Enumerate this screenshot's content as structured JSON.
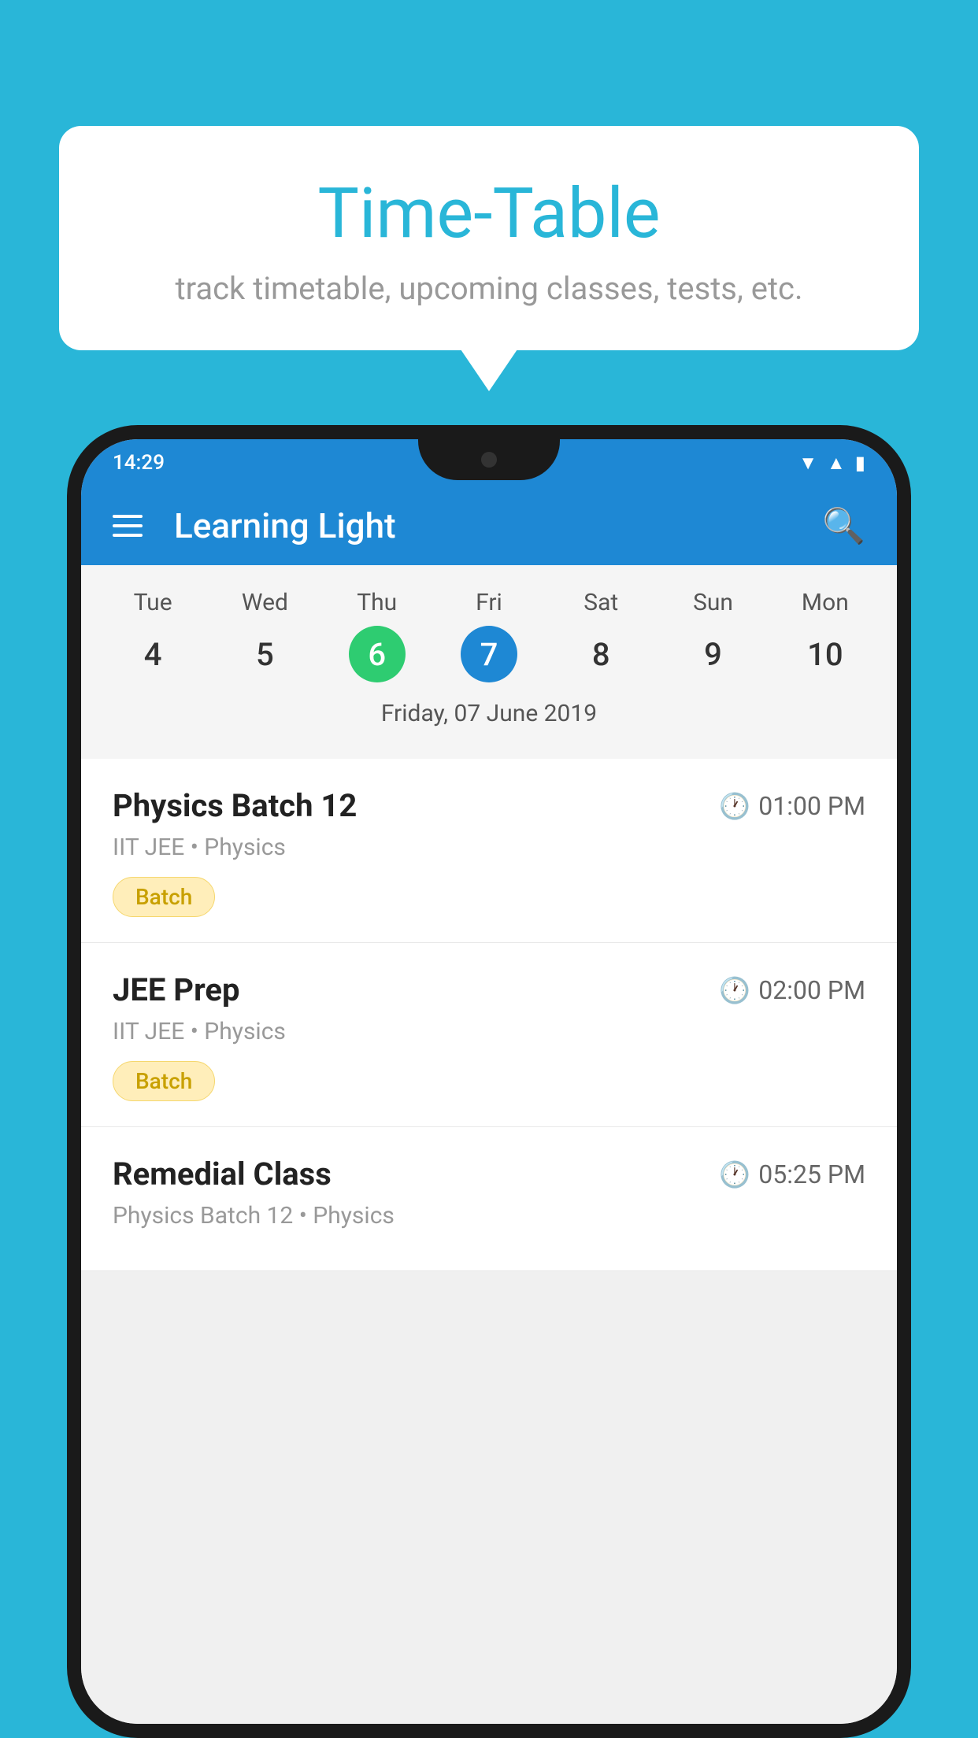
{
  "background_color": "#29b6d8",
  "bubble": {
    "title": "Time-Table",
    "subtitle": "track timetable, upcoming classes, tests, etc."
  },
  "app": {
    "title": "Learning Light",
    "menu_icon": "hamburger-icon",
    "search_icon": "search-icon"
  },
  "status_bar": {
    "time": "14:29",
    "icons": [
      "wifi",
      "signal",
      "battery"
    ]
  },
  "calendar": {
    "days": [
      {
        "name": "Tue",
        "number": "4",
        "state": "normal"
      },
      {
        "name": "Wed",
        "number": "5",
        "state": "normal"
      },
      {
        "name": "Thu",
        "number": "6",
        "state": "today"
      },
      {
        "name": "Fri",
        "number": "7",
        "state": "selected"
      },
      {
        "name": "Sat",
        "number": "8",
        "state": "normal"
      },
      {
        "name": "Sun",
        "number": "9",
        "state": "normal"
      },
      {
        "name": "Mon",
        "number": "10",
        "state": "normal"
      }
    ],
    "selected_date_label": "Friday, 07 June 2019"
  },
  "events": [
    {
      "name": "Physics Batch 12",
      "time": "01:00 PM",
      "meta": "IIT JEE • Physics",
      "tag": "Batch"
    },
    {
      "name": "JEE Prep",
      "time": "02:00 PM",
      "meta": "IIT JEE • Physics",
      "tag": "Batch"
    },
    {
      "name": "Remedial Class",
      "time": "05:25 PM",
      "meta": "Physics Batch 12 • Physics",
      "tag": ""
    }
  ]
}
